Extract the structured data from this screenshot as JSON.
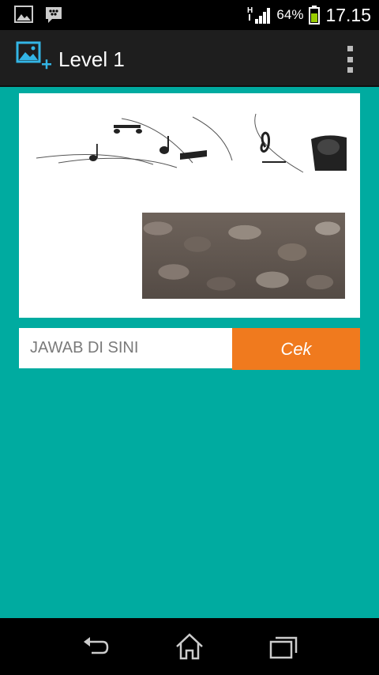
{
  "status_bar": {
    "network_label": "H",
    "battery_percent": "64%",
    "time": "17.15"
  },
  "action_bar": {
    "title": "Level 1",
    "icon": "add-image-icon",
    "overflow_icon": "overflow-menu-icon"
  },
  "puzzle": {
    "image_top": "music-notes-illustration",
    "image_bottom": "rocks-photo"
  },
  "answer": {
    "placeholder": "JAWAB DI SINI",
    "value": "",
    "submit_label": "Cek"
  },
  "colors": {
    "background": "#00ABA0",
    "submit_button": "#F07A1E",
    "action_bar": "#1E1E1E",
    "accent_icon": "#33B5E5"
  },
  "nav_bar": {
    "back_icon": "back-icon",
    "home_icon": "home-icon",
    "recents_icon": "recent-apps-icon"
  }
}
